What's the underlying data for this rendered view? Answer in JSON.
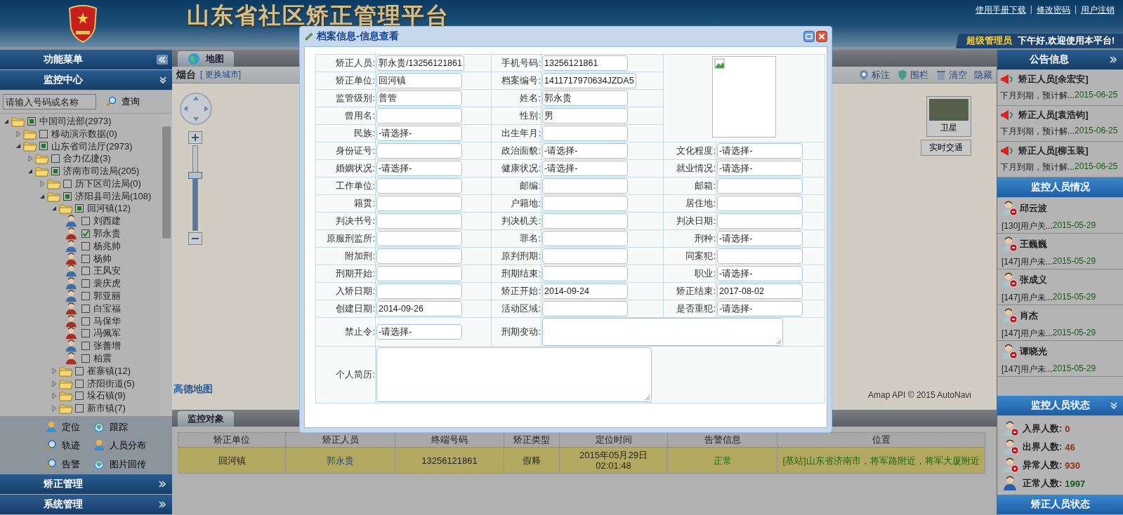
{
  "header": {
    "title": "山东省社区矫正管理平台",
    "links": [
      "使用手册下载",
      "修改密码",
      "用户注销"
    ],
    "separator": "|",
    "role": "超级管理员",
    "greeting": "下午好,欢迎使用本平台!"
  },
  "left_panel": {
    "menu_title": "功能菜单",
    "monitor_title": "监控中心",
    "search": {
      "placeholder": "请输入号码或名称",
      "button": "查询"
    },
    "tree": [
      {
        "label": "中国司法部(2973)",
        "kind": "folder",
        "expanded": true,
        "mixed": true,
        "children": [
          {
            "label": "移动演示数据(0)",
            "kind": "folder",
            "expanded": false,
            "mixed": false
          },
          {
            "label": "山东省司法厅(2973)",
            "kind": "folder",
            "expanded": true,
            "mixed": true,
            "children": [
              {
                "label": "合力亿捷(3)",
                "kind": "folder",
                "expanded": false,
                "mixed": false
              },
              {
                "label": "济南市司法局(205)",
                "kind": "folder",
                "expanded": true,
                "mixed": true,
                "children": [
                  {
                    "label": "历下区司法局(0)",
                    "kind": "folder",
                    "expanded": false,
                    "mixed": false
                  },
                  {
                    "label": "济阳县司法局(108)",
                    "kind": "folder",
                    "expanded": true,
                    "mixed": true,
                    "children": [
                      {
                        "label": "回河镇(12)",
                        "kind": "folder",
                        "expanded": true,
                        "mixed": true,
                        "children": [
                          {
                            "label": "刘西建",
                            "kind": "person",
                            "color": "#3a6ea8",
                            "checked": false
                          },
                          {
                            "label": "郭永贵",
                            "kind": "person",
                            "color": "#a83020",
                            "checked": true
                          },
                          {
                            "label": "杨兆帅",
                            "kind": "person",
                            "color": "#3a6ea8",
                            "checked": false
                          },
                          {
                            "label": "杨帅",
                            "kind": "person",
                            "color": "#a83020",
                            "checked": false
                          },
                          {
                            "label": "王风安",
                            "kind": "person",
                            "color": "#3a6ea8",
                            "checked": false
                          },
                          {
                            "label": "裴庆虎",
                            "kind": "person",
                            "color": "#3a6ea8",
                            "checked": false
                          },
                          {
                            "label": "郭亚丽",
                            "kind": "person",
                            "color": "#3a6ea8",
                            "checked": false
                          },
                          {
                            "label": "白宝福",
                            "kind": "person",
                            "color": "#a83020",
                            "checked": false
                          },
                          {
                            "label": "马保华",
                            "kind": "person",
                            "color": "#a83020",
                            "checked": false
                          },
                          {
                            "label": "冯佩军",
                            "kind": "person",
                            "color": "#a83020",
                            "checked": false
                          },
                          {
                            "label": "张善增",
                            "kind": "person",
                            "color": "#3a6ea8",
                            "checked": false
                          },
                          {
                            "label": "柏震",
                            "kind": "person",
                            "color": "#a83020",
                            "checked": false
                          }
                        ]
                      },
                      {
                        "label": "崔寨镇(12)",
                        "kind": "folder",
                        "expanded": false,
                        "mixed": false
                      },
                      {
                        "label": "济阳街道(5)",
                        "kind": "folder",
                        "expanded": false,
                        "mixed": false
                      },
                      {
                        "label": "垛石镇(9)",
                        "kind": "folder",
                        "expanded": false,
                        "mixed": false
                      },
                      {
                        "label": "新市镇(7)",
                        "kind": "folder",
                        "expanded": false,
                        "mixed": false
                      }
                    ]
                  }
                ]
              }
            ]
          }
        ]
      }
    ],
    "actions": [
      {
        "label": "定位",
        "kind": "person"
      },
      {
        "label": "跟踪",
        "kind": "refresh"
      },
      {
        "label": "轨迹",
        "kind": "search"
      },
      {
        "label": "人员分布",
        "kind": "person"
      },
      {
        "label": "告警",
        "kind": "search"
      },
      {
        "label": "图片回传",
        "kind": "refresh"
      }
    ],
    "sections": [
      "矫正管理",
      "系统管理"
    ]
  },
  "map": {
    "tab": "地图",
    "city": "烟台",
    "change_city": "[ 更换城市]",
    "tools": [
      {
        "label": "标注",
        "kind": "pin"
      },
      {
        "label": "围栏",
        "kind": "shield"
      },
      {
        "label": "清空",
        "kind": "trash"
      },
      {
        "label": "隐藏",
        "kind": "plain"
      }
    ],
    "satellite": "卫星",
    "traffic": "实时交通",
    "logo": "高德地图",
    "credit": "Amap API © 2015 AutoNavi",
    "zoom": {
      "level": 0.64
    }
  },
  "bottom": {
    "tab": "监控对象",
    "table": {
      "columns": [
        "矫正单位",
        "矫正人员",
        "终端号码",
        "矫正类型",
        "定位时间",
        "告警信息",
        "位置"
      ],
      "rows": [
        {
          "selected": true,
          "cells": [
            "回河镇",
            "郭永贵",
            "13256121861",
            "假释",
            "2015年05月29日\n02:01:48",
            "正常",
            "[基站]山东省济南市，将军路附近，将军大厦附近"
          ]
        }
      ]
    }
  },
  "right_panel": {
    "notices": {
      "title": "公告信息",
      "items": [
        {
          "title": "矫正人员[余宏安]",
          "text": "下月到期，预计解...",
          "date": "2015-06-25"
        },
        {
          "title": "矫正人员[袁浩钧]",
          "text": "下月到期，预计解...",
          "date": "2015-06-25"
        },
        {
          "title": "矫正人员[柳玉装]",
          "text": "下月到期，预计解...",
          "date": "2015-06-25"
        }
      ]
    },
    "monitor": {
      "title": "监控人员情况",
      "items": [
        {
          "name": "邱云波",
          "text": "[130]用户关...",
          "date": "2015-05-29"
        },
        {
          "name": "王巍巍",
          "text": "[147]用户未...",
          "date": "2015-05-29"
        },
        {
          "name": "张成义",
          "text": "[147]用户未...",
          "date": "2015-05-29"
        },
        {
          "name": "肖杰",
          "text": "[147]用户未...",
          "date": "2015-05-29"
        },
        {
          "name": "谭晓光",
          "text": "[147]用户未...",
          "date": "2015-05-29"
        }
      ]
    },
    "status": {
      "title": "监控人员状态",
      "items": [
        {
          "label": "入界人数:",
          "value": "0",
          "kind": "in"
        },
        {
          "label": "出界人数:",
          "value": "46",
          "kind": "out"
        },
        {
          "label": "异常人数:",
          "value": "930",
          "kind": "abnormal"
        },
        {
          "label": "正常人数:",
          "value": "1997",
          "kind": "normal"
        }
      ]
    },
    "footer": "矫正人员状态"
  },
  "dialog": {
    "title": "档案信息-信息查看",
    "rows": [
      [
        {
          "label": "矫正人员:",
          "kind": "text",
          "value": "郭永贵/13256121861"
        },
        {
          "label": "手机号码:",
          "kind": "text",
          "value": "13256121861"
        }
      ],
      [
        {
          "label": "矫正单位:",
          "kind": "text",
          "value": "回河镇"
        },
        {
          "label": "档案编号:",
          "kind": "text",
          "value": "1411717970634JZDA5"
        }
      ],
      [
        {
          "label": "监管级别:",
          "kind": "text",
          "value": "普管"
        },
        {
          "label": "姓名:",
          "kind": "text",
          "value": "郭永贵"
        }
      ],
      [
        {
          "label": "曾用名:",
          "kind": "text"
        },
        {
          "label": "性别:",
          "kind": "text",
          "value": "男"
        }
      ],
      [
        {
          "label": "民族:",
          "kind": "text",
          "value": "-请选择-"
        },
        {
          "label": "出生年月:",
          "kind": "text"
        }
      ],
      [
        {
          "label": "身份证号:",
          "kind": "text"
        },
        {
          "label": "政治面貌:",
          "kind": "text",
          "value": "-请选择-"
        },
        {
          "label": "文化程度:",
          "kind": "text",
          "value": "-请选择-"
        }
      ],
      [
        {
          "label": "婚姻状况:",
          "kind": "text",
          "value": "-请选择-"
        },
        {
          "label": "健康状况:",
          "kind": "text",
          "value": "-请选择-"
        },
        {
          "label": "就业情况:",
          "kind": "text",
          "value": "-请选择-"
        }
      ],
      [
        {
          "label": "工作单位:",
          "kind": "text"
        },
        {
          "label": "邮编:",
          "kind": "text"
        },
        {
          "label": "邮箱:",
          "kind": "text"
        }
      ],
      [
        {
          "label": "籍贯:",
          "kind": "text"
        },
        {
          "label": "户籍地:",
          "kind": "text"
        },
        {
          "label": "居住地:",
          "kind": "text"
        }
      ],
      [
        {
          "label": "判决书号:",
          "kind": "text"
        },
        {
          "label": "判决机关:",
          "kind": "text"
        },
        {
          "label": "判决日期:",
          "kind": "text"
        }
      ],
      [
        {
          "label": "原服刑监所:",
          "kind": "text"
        },
        {
          "label": "罪名:",
          "kind": "text"
        },
        {
          "label": "刑种:",
          "kind": "text",
          "value": "-请选择-"
        }
      ],
      [
        {
          "label": "附加刑:",
          "kind": "text"
        },
        {
          "label": "原判刑期:",
          "kind": "text"
        },
        {
          "label": "同案犯:",
          "kind": "text"
        }
      ],
      [
        {
          "label": "刑期开始:",
          "kind": "text"
        },
        {
          "label": "刑期结束:",
          "kind": "text"
        },
        {
          "label": "职业:",
          "kind": "text",
          "value": "-请选择-"
        }
      ],
      [
        {
          "label": "入矫日期:",
          "kind": "text"
        },
        {
          "label": "矫正开始:",
          "kind": "text",
          "value": "2014-09-24"
        },
        {
          "label": "矫正结束:",
          "kind": "text",
          "value": "2017-08-02"
        }
      ],
      [
        {
          "label": "创建日期:",
          "kind": "text",
          "value": "2014-09-26"
        },
        {
          "label": "活动区域:",
          "kind": "text"
        },
        {
          "label": "是否重犯:",
          "kind": "text",
          "value": "-请选择-"
        }
      ],
      [
        {
          "label": "禁止令:",
          "kind": "text",
          "value": "-请选择-"
        },
        {
          "label": "刑期变动:",
          "kind": "textarea"
        }
      ],
      [
        {
          "label": "个人简历:",
          "kind": "textarea"
        }
      ]
    ]
  }
}
